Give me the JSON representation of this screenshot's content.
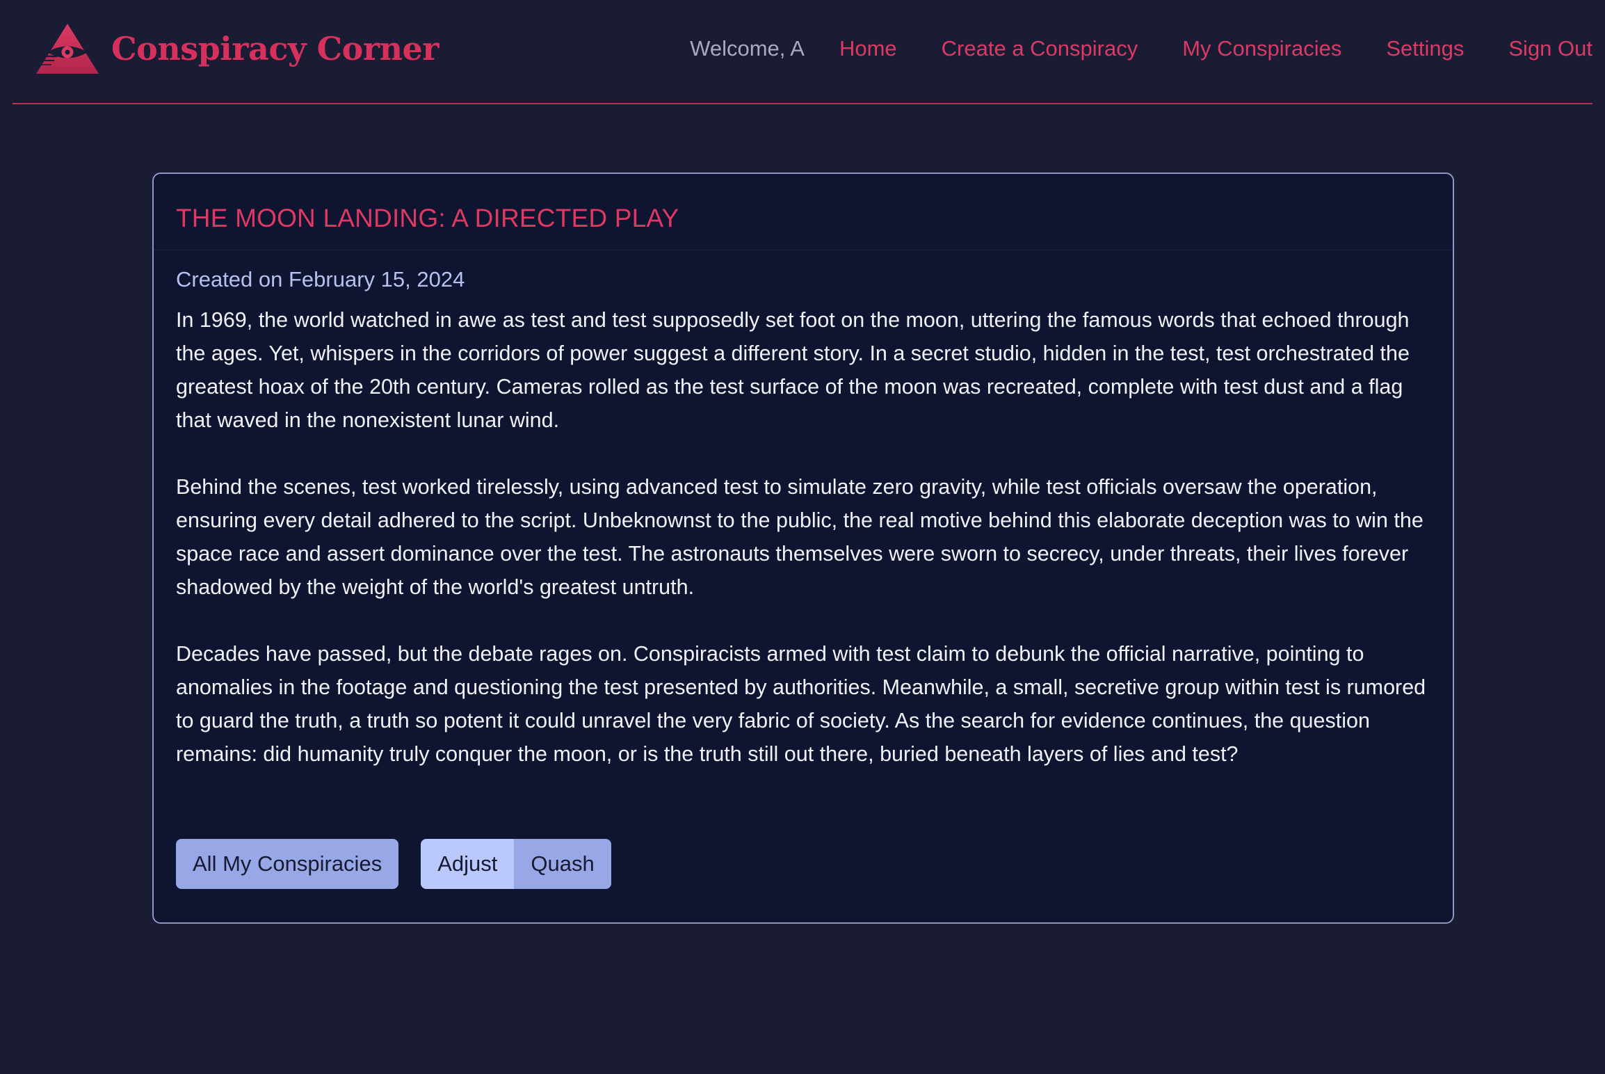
{
  "brand": {
    "logo_icon": "all-seeing-eye-triangle-icon",
    "name": "Conspiracy Corner"
  },
  "nav": {
    "welcome": "Welcome, A",
    "links": [
      "Home",
      "Create a Conspiracy",
      "My Conspiracies",
      "Settings",
      "Sign Out"
    ]
  },
  "conspiracy": {
    "title": "THE MOON LANDING: A DIRECTED PLAY",
    "created": "Created on February 15, 2024",
    "paragraphs": [
      "In 1969, the world watched in awe as test and test supposedly set foot on the moon, uttering the famous words that echoed through the ages. Yet, whispers in the corridors of power suggest a different story. In a secret studio, hidden in the test, test orchestrated the greatest hoax of the 20th century. Cameras rolled as the test surface of the moon was recreated, complete with test dust and a flag that waved in the nonexistent lunar wind.",
      "Behind the scenes, test worked tirelessly, using advanced test to simulate zero gravity, while test officials oversaw the operation, ensuring every detail adhered to the script. Unbeknownst to the public, the real motive behind this elaborate deception was to win the space race and assert dominance over the test. The astronauts themselves were sworn to secrecy, under threats, their lives forever shadowed by the weight of the world's greatest untruth.",
      "Decades have passed, but the debate rages on. Conspiracists armed with test claim to debunk the official narrative, pointing to anomalies in the footage and questioning the test presented by authorities. Meanwhile, a small, secretive group within test is rumored to guard the truth, a truth so potent it could unravel the very fabric of society. As the search for evidence continues, the question remains: did humanity truly conquer the moon, or is the truth still out there, buried beneath layers of lies and test?"
    ]
  },
  "actions": {
    "all_label": "All My Conspiracies",
    "adjust_label": "Adjust",
    "quash_label": "Quash"
  },
  "colors": {
    "background": "#1a1c34",
    "card": "#0f1430",
    "accent": "#dd3962",
    "button_primary": "#98a8e6",
    "button_light": "#bac8fb"
  }
}
